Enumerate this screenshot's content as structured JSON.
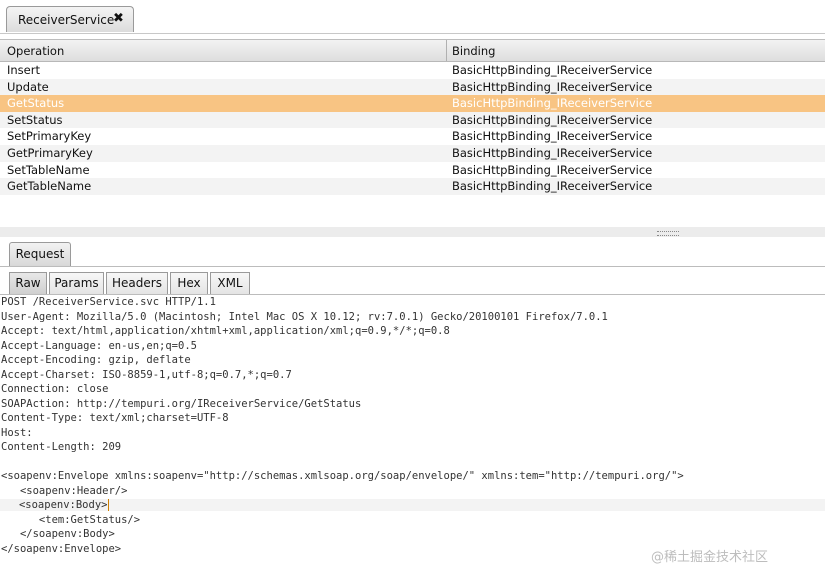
{
  "window_tab": {
    "label": "ReceiverService",
    "close_glyph": "✖"
  },
  "operations_table": {
    "columns": [
      "Operation",
      "Binding"
    ],
    "rows": [
      {
        "operation": "Insert",
        "binding": "BasicHttpBinding_IReceiverService"
      },
      {
        "operation": "Update",
        "binding": "BasicHttpBinding_IReceiverService"
      },
      {
        "operation": "GetStatus",
        "binding": "BasicHttpBinding_IReceiverService",
        "selected": true
      },
      {
        "operation": "SetStatus",
        "binding": "BasicHttpBinding_IReceiverService"
      },
      {
        "operation": "SetPrimaryKey",
        "binding": "BasicHttpBinding_IReceiverService"
      },
      {
        "operation": "GetPrimaryKey",
        "binding": "BasicHttpBinding_IReceiverService"
      },
      {
        "operation": "SetTableName",
        "binding": "BasicHttpBinding_IReceiverService"
      },
      {
        "operation": "GetTableName",
        "binding": "BasicHttpBinding_IReceiverService"
      }
    ],
    "selected_color": "#f8c483"
  },
  "request_panel": {
    "tab_label": "Request",
    "subtabs": [
      "Raw",
      "Params",
      "Headers",
      "Hex",
      "XML"
    ],
    "active_subtab": "Raw"
  },
  "raw_request": {
    "lines": [
      "POST /ReceiverService.svc HTTP/1.1",
      "User-Agent: Mozilla/5.0 (Macintosh; Intel Mac OS X 10.12; rv:7.0.1) Gecko/20100101 Firefox/7.0.1",
      "Accept: text/html,application/xhtml+xml,application/xml;q=0.9,*/*;q=0.8",
      "Accept-Language: en-us,en;q=0.5",
      "Accept-Encoding: gzip, deflate",
      "Accept-Charset: ISO-8859-1,utf-8;q=0.7,*;q=0.7",
      "Connection: close",
      "SOAPAction: http://tempuri.org/IReceiverService/GetStatus",
      "Content-Type: text/xml;charset=UTF-8",
      "Host:",
      "Content-Length: 209",
      "",
      "<soapenv:Envelope xmlns:soapenv=\"http://schemas.xmlsoap.org/soap/envelope/\" xmlns:tem=\"http://tempuri.org/\">",
      "   <soapenv:Header/>",
      "   <soapenv:Body>",
      "      <tem:GetStatus/>",
      "   </soapenv:Body>",
      "</soapenv:Envelope>"
    ],
    "highlighted_line": 14
  },
  "watermark": "@稀土掘金技术社区"
}
